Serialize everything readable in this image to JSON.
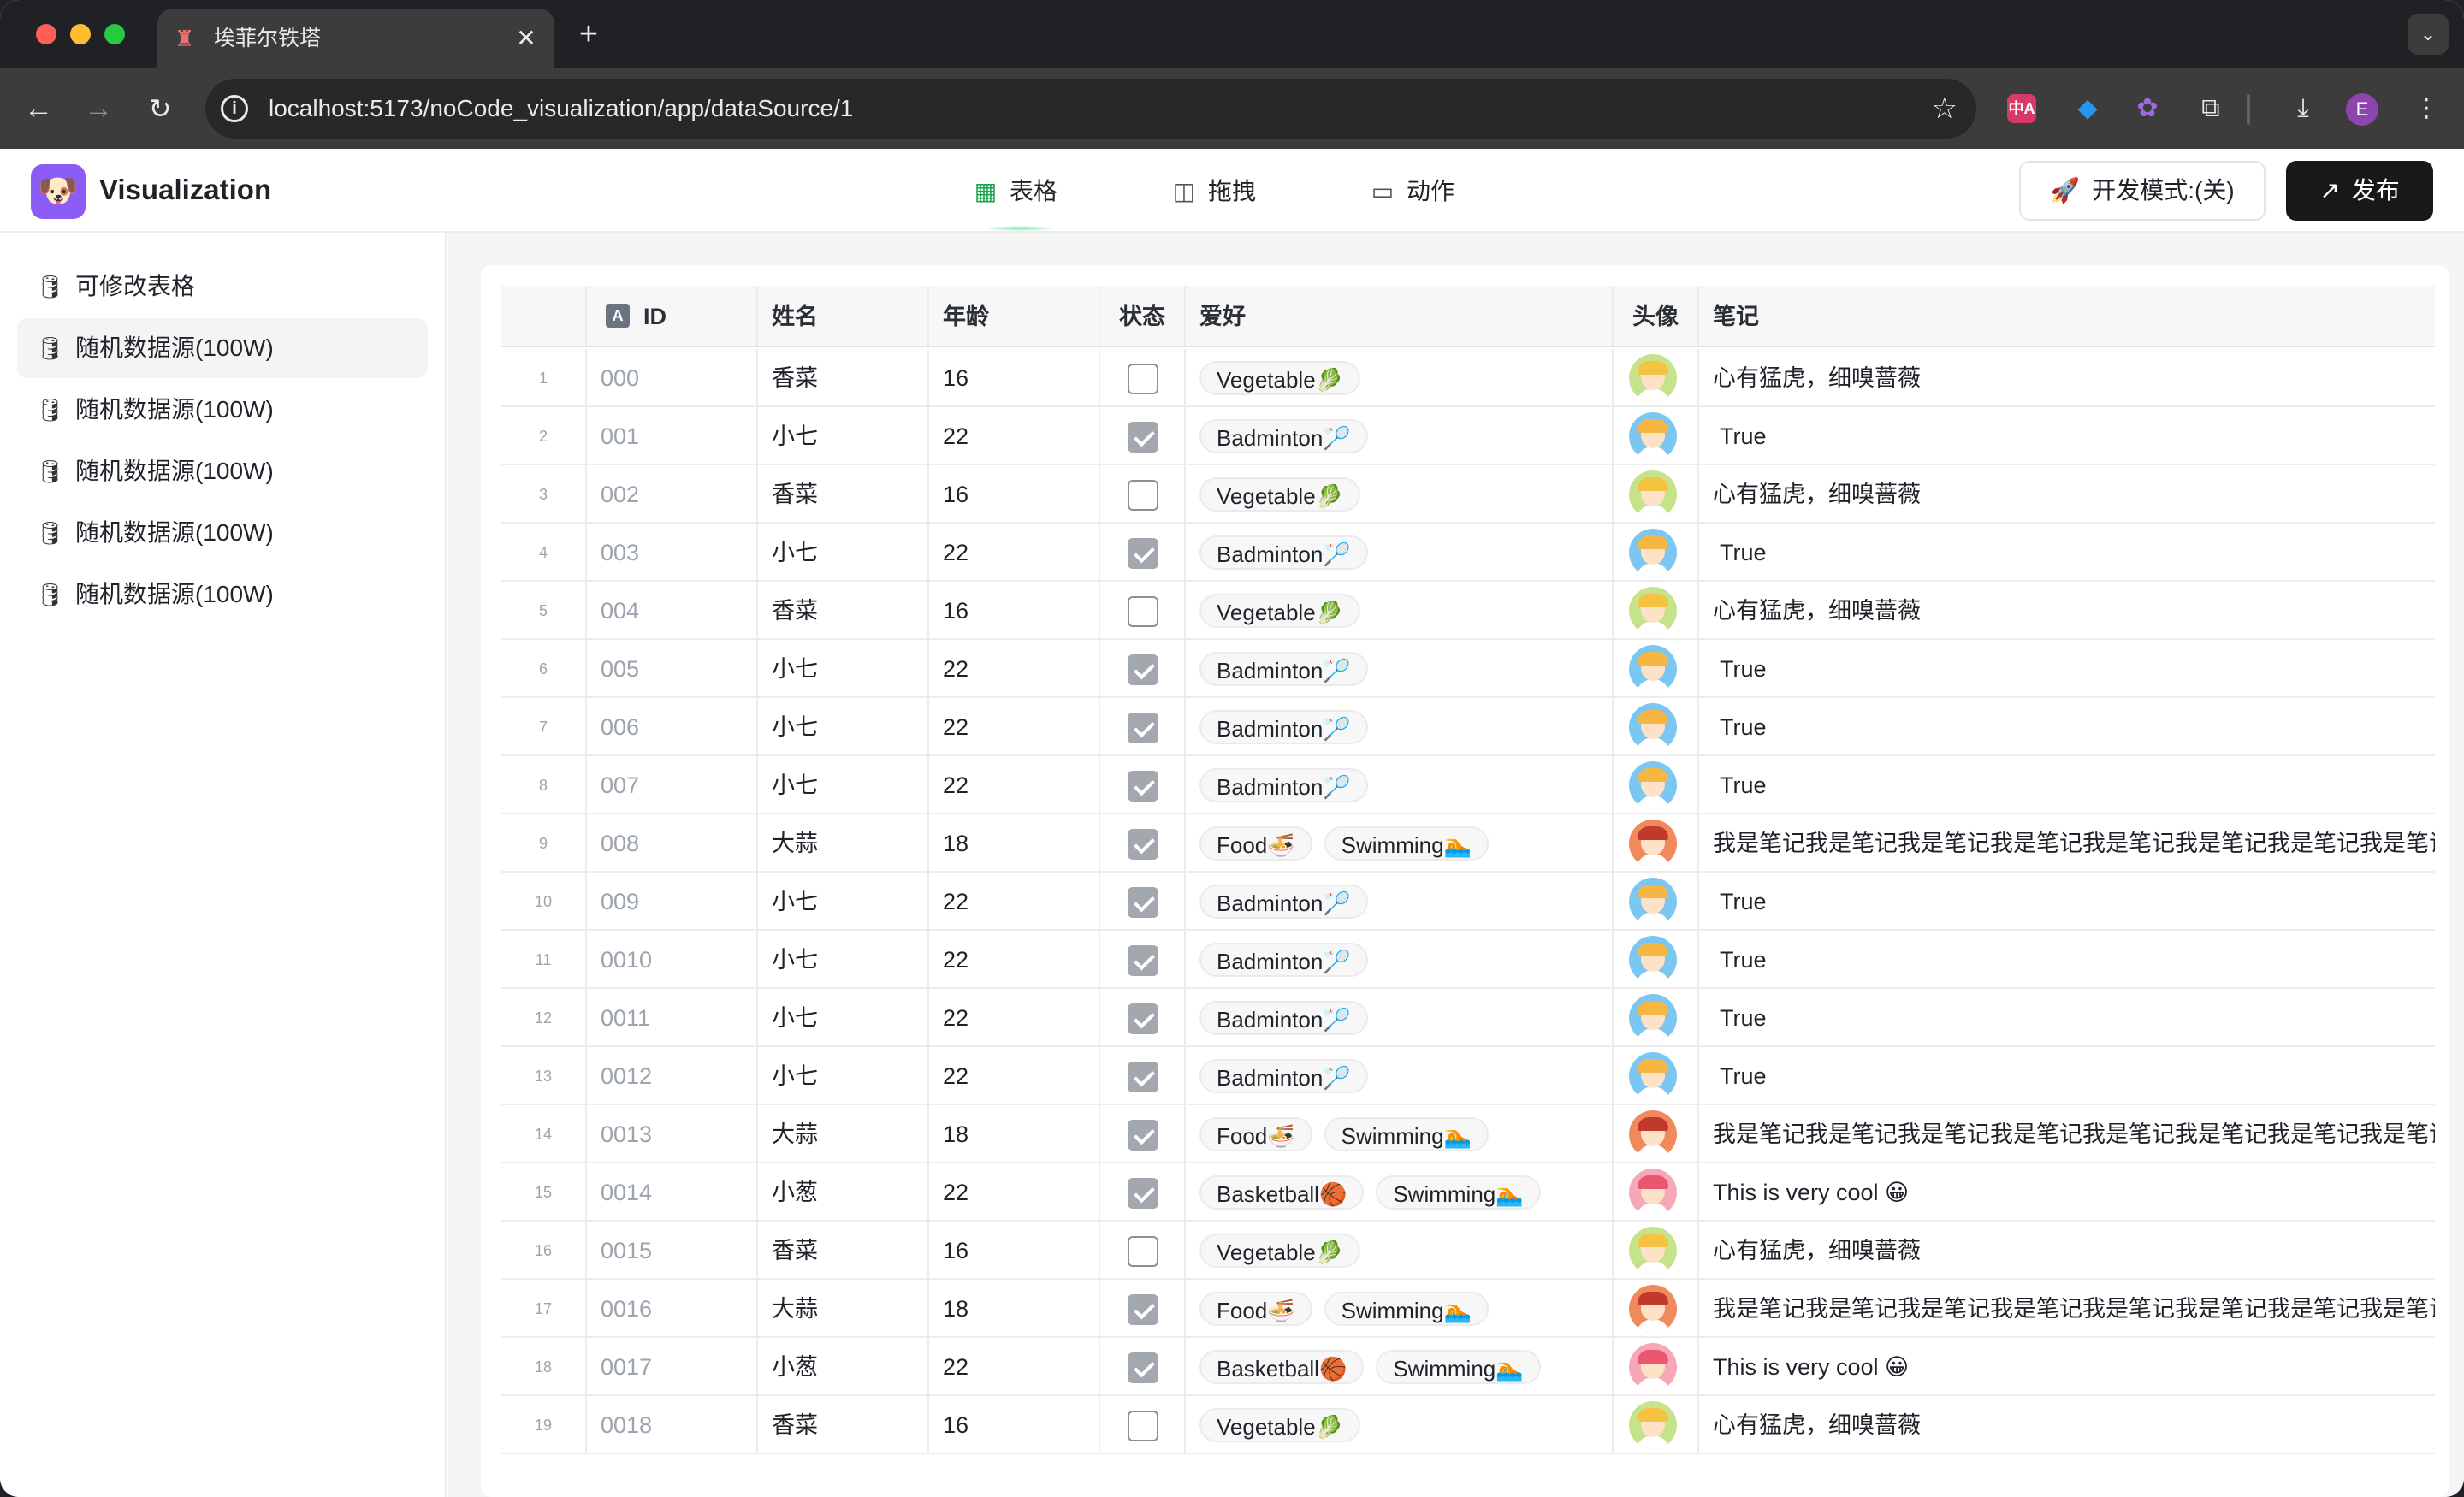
{
  "browser": {
    "tab_title": "埃菲尔铁塔",
    "tab_close": "✕",
    "new_tab": "+",
    "tab_menu": "⌄",
    "url": "localhost:5173/noCode_visualization/app/dataSource/1",
    "profile_initial": "E",
    "translate_label": "中A"
  },
  "header": {
    "brand": "Visualization",
    "tabs": [
      {
        "label": "表格",
        "icon": "table-icon"
      },
      {
        "label": "拖拽",
        "icon": "drag-panel-icon"
      },
      {
        "label": "动作",
        "icon": "action-monitor-icon"
      }
    ],
    "dev_mode_label": "开发模式:(关)",
    "publish_label": "发布"
  },
  "sidebar": {
    "items": [
      {
        "label": "可修改表格"
      },
      {
        "label": "随机数据源(100W)"
      },
      {
        "label": "随机数据源(100W)"
      },
      {
        "label": "随机数据源(100W)"
      },
      {
        "label": "随机数据源(100W)"
      },
      {
        "label": "随机数据源(100W)"
      }
    ],
    "active_index": 1
  },
  "table": {
    "columns": [
      "ID",
      "姓名",
      "年龄",
      "状态",
      "爱好",
      "头像",
      "笔记"
    ],
    "id_badge": "A",
    "rows": [
      {
        "n": "1",
        "id": "000",
        "name": "香菜",
        "age": "16",
        "status": false,
        "hobbies": [
          "Vegetable🥬"
        ],
        "avatar": "green",
        "notes": "心有猛虎，细嗅蔷薇"
      },
      {
        "n": "2",
        "id": "001",
        "name": "小七",
        "age": "22",
        "status": true,
        "hobbies": [
          "Badminton🏸"
        ],
        "avatar": "blue",
        "notes": "True"
      },
      {
        "n": "3",
        "id": "002",
        "name": "香菜",
        "age": "16",
        "status": false,
        "hobbies": [
          "Vegetable🥬"
        ],
        "avatar": "green",
        "notes": "心有猛虎，细嗅蔷薇"
      },
      {
        "n": "4",
        "id": "003",
        "name": "小七",
        "age": "22",
        "status": true,
        "hobbies": [
          "Badminton🏸"
        ],
        "avatar": "blue",
        "notes": "True"
      },
      {
        "n": "5",
        "id": "004",
        "name": "香菜",
        "age": "16",
        "status": false,
        "hobbies": [
          "Vegetable🥬"
        ],
        "avatar": "green",
        "notes": "心有猛虎，细嗅蔷薇"
      },
      {
        "n": "6",
        "id": "005",
        "name": "小七",
        "age": "22",
        "status": true,
        "hobbies": [
          "Badminton🏸"
        ],
        "avatar": "blue",
        "notes": "True"
      },
      {
        "n": "7",
        "id": "006",
        "name": "小七",
        "age": "22",
        "status": true,
        "hobbies": [
          "Badminton🏸"
        ],
        "avatar": "blue",
        "notes": "True"
      },
      {
        "n": "8",
        "id": "007",
        "name": "小七",
        "age": "22",
        "status": true,
        "hobbies": [
          "Badminton🏸"
        ],
        "avatar": "blue",
        "notes": "True"
      },
      {
        "n": "9",
        "id": "008",
        "name": "大蒜",
        "age": "18",
        "status": true,
        "hobbies": [
          "Food🍜",
          "Swimming🏊"
        ],
        "avatar": "orange",
        "notes": "我是笔记我是笔记我是笔记我是笔记我是笔记我是笔记我是笔记我是笔记"
      },
      {
        "n": "10",
        "id": "009",
        "name": "小七",
        "age": "22",
        "status": true,
        "hobbies": [
          "Badminton🏸"
        ],
        "avatar": "blue",
        "notes": "True"
      },
      {
        "n": "11",
        "id": "0010",
        "name": "小七",
        "age": "22",
        "status": true,
        "hobbies": [
          "Badminton🏸"
        ],
        "avatar": "blue",
        "notes": "True"
      },
      {
        "n": "12",
        "id": "0011",
        "name": "小七",
        "age": "22",
        "status": true,
        "hobbies": [
          "Badminton🏸"
        ],
        "avatar": "blue",
        "notes": "True"
      },
      {
        "n": "13",
        "id": "0012",
        "name": "小七",
        "age": "22",
        "status": true,
        "hobbies": [
          "Badminton🏸"
        ],
        "avatar": "blue",
        "notes": "True"
      },
      {
        "n": "14",
        "id": "0013",
        "name": "大蒜",
        "age": "18",
        "status": true,
        "hobbies": [
          "Food🍜",
          "Swimming🏊"
        ],
        "avatar": "orange",
        "notes": "我是笔记我是笔记我是笔记我是笔记我是笔记我是笔记我是笔记我是笔记"
      },
      {
        "n": "15",
        "id": "0014",
        "name": "小葱",
        "age": "22",
        "status": true,
        "hobbies": [
          "Basketball🏀",
          "Swimming🏊"
        ],
        "avatar": "pink",
        "notes": "This is very cool 😀"
      },
      {
        "n": "16",
        "id": "0015",
        "name": "香菜",
        "age": "16",
        "status": false,
        "hobbies": [
          "Vegetable🥬"
        ],
        "avatar": "green",
        "notes": "心有猛虎，细嗅蔷薇"
      },
      {
        "n": "17",
        "id": "0016",
        "name": "大蒜",
        "age": "18",
        "status": true,
        "hobbies": [
          "Food🍜",
          "Swimming🏊"
        ],
        "avatar": "orange",
        "notes": "我是笔记我是笔记我是笔记我是笔记我是笔记我是笔记我是笔记我是笔记"
      },
      {
        "n": "18",
        "id": "0017",
        "name": "小葱",
        "age": "22",
        "status": true,
        "hobbies": [
          "Basketball🏀",
          "Swimming🏊"
        ],
        "avatar": "pink",
        "notes": "This is very cool 😀"
      },
      {
        "n": "19",
        "id": "0018",
        "name": "香菜",
        "age": "16",
        "status": false,
        "hobbies": [
          "Vegetable🥬"
        ],
        "avatar": "green",
        "notes": "心有猛虎，细嗅蔷薇"
      }
    ]
  },
  "colors": {
    "accent_green": "#16a34a",
    "publish_bg": "#18181b",
    "logo_bg": "#8b5cf6"
  }
}
